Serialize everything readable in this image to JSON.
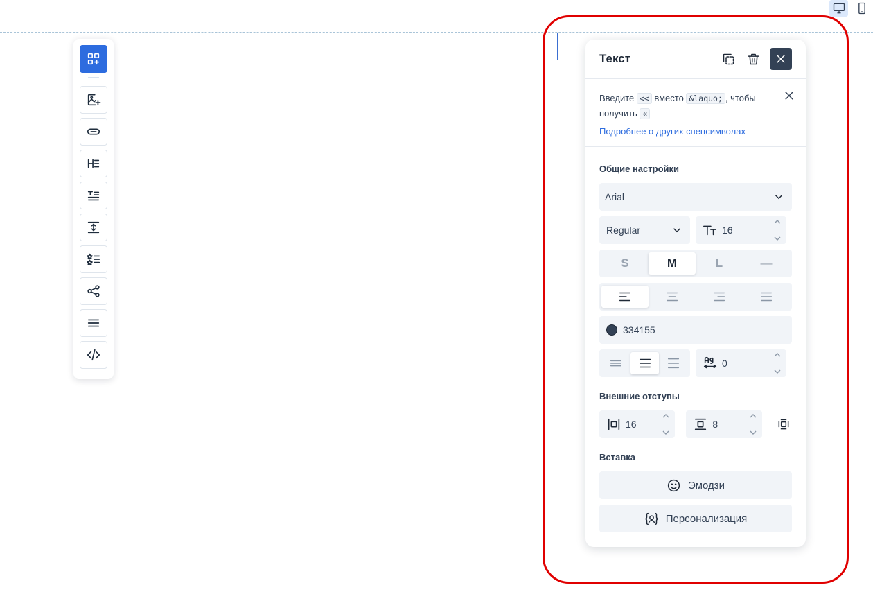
{
  "device_switch": {
    "desktop_icon": "monitor-icon",
    "mobile_icon": "phone-icon",
    "active": "desktop"
  },
  "toolbar": {
    "items": [
      {
        "name": "add-block",
        "icon": "grid-plus-icon"
      },
      {
        "name": "image",
        "icon": "image-plus-icon"
      },
      {
        "name": "button",
        "icon": "pill-icon"
      },
      {
        "name": "heading",
        "icon": "heading-icon"
      },
      {
        "name": "text",
        "icon": "text-icon"
      },
      {
        "name": "spacer",
        "icon": "vertical-spacing-icon"
      },
      {
        "name": "list",
        "icon": "star-list-icon"
      },
      {
        "name": "social",
        "icon": "share-icon"
      },
      {
        "name": "menu",
        "icon": "menu-icon"
      },
      {
        "name": "html",
        "icon": "code-icon"
      }
    ]
  },
  "panel": {
    "title": "Текст",
    "notice": {
      "part1": "Введите ",
      "code1": "<<",
      "part2": " вместо ",
      "code2": "&laquo;",
      "part3": ", чтобы получить ",
      "code3": "«",
      "link": "Подробнее о других спецсимволах"
    },
    "general": {
      "title": "Общие настройки",
      "font": "Arial",
      "weight": "Regular",
      "size": "16",
      "sizes": [
        "S",
        "M",
        "L",
        "—"
      ],
      "active_size": "M",
      "align_active": "left",
      "color_hex": "#334155",
      "color": "334155",
      "letter_spacing": "0"
    },
    "margins": {
      "title": "Внешние отступы",
      "horizontal": "16",
      "vertical": "8"
    },
    "insert": {
      "title": "Вставка",
      "emoji": "Эмодзи",
      "personalization": "Персонализация"
    }
  },
  "colors": {
    "accent": "#2d6cdf",
    "highlight": "#e00000",
    "close_bg": "#334155"
  }
}
